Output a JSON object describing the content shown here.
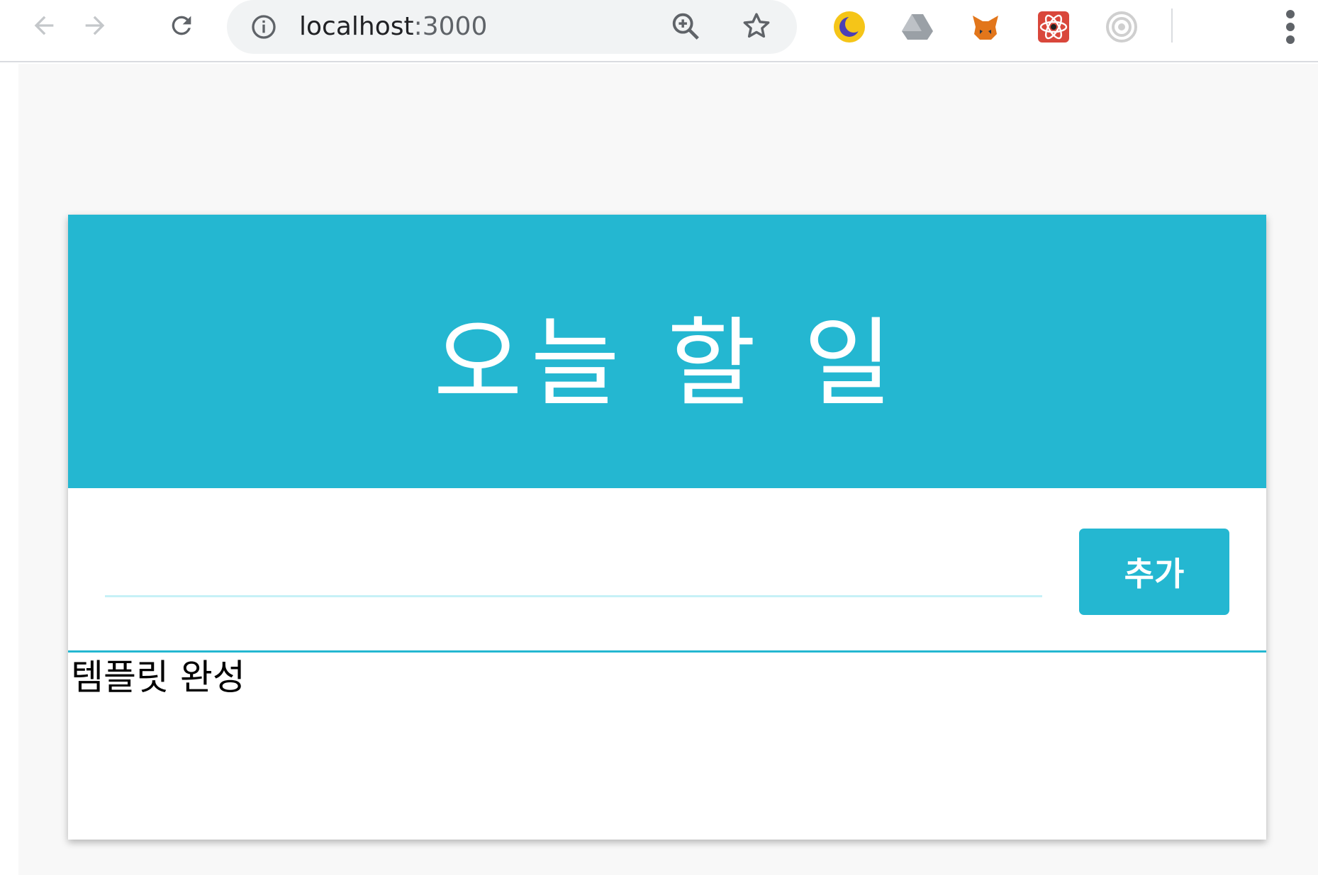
{
  "browser": {
    "url_host": "localhost",
    "url_port": ":3000",
    "icons": {
      "back": "arrow-left-icon",
      "forward": "arrow-right-icon",
      "reload": "reload-icon",
      "site_info": "info-icon",
      "zoom": "zoom-in-icon",
      "bookmark": "star-icon",
      "menu": "three-dots-menu-icon"
    },
    "extensions": [
      {
        "name": "moon-extension-icon",
        "color": "#f5c518"
      },
      {
        "name": "drive-extension-icon",
        "color": "#9aa0a6"
      },
      {
        "name": "metamask-fox-icon",
        "color": "#e2761b"
      },
      {
        "name": "react-devtools-icon",
        "color": "#d9473b"
      },
      {
        "name": "target-extension-icon",
        "color": "#bdbdbd"
      }
    ]
  },
  "app": {
    "title": "오늘 할 일",
    "input_value": "",
    "add_button_label": "추가",
    "todos": [
      {
        "text": "템플릿 완성"
      }
    ],
    "colors": {
      "accent": "#24b7d1",
      "input_underline": "#c7f1f7",
      "page_background": "#f8f8f8"
    }
  }
}
